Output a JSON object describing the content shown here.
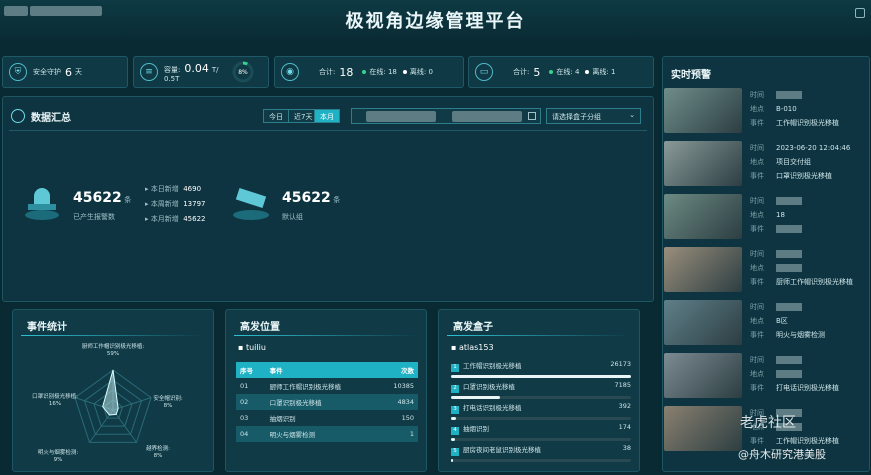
{
  "header": {
    "title": "极视角边缘管理平台"
  },
  "stats": [
    {
      "label": "安全守护",
      "value": "6",
      "unit": "天"
    },
    {
      "label": "容量:",
      "value": "0.04",
      "unit": "T/",
      "sub": "0.5T",
      "percent_label": "8%",
      "percent": 0.08
    },
    {
      "label": "合计:",
      "value": "18",
      "online_label": "在线:",
      "online": "18",
      "offline_label": "离线:",
      "offline": "0"
    },
    {
      "label": "合计:",
      "value": "5",
      "online_label": "在线:",
      "online": "4",
      "offline_label": "离线:",
      "offline": "1"
    }
  ],
  "summary": {
    "title": "数据汇总",
    "ranges": [
      "今日",
      "近7天",
      "本月"
    ],
    "active_range": "本月",
    "group_placeholder": "请选择盒子分组",
    "alarm_total": "45622",
    "alarm_unit": "条",
    "alarm_label": "已产生报警数",
    "today_label": "本日新增",
    "today_value": "4690",
    "week_label": "本周新增",
    "week_value": "13797",
    "month_label": "本月新增",
    "month_value": "45622",
    "default_total": "45622",
    "default_unit": "条",
    "default_label": "默认组"
  },
  "event_stats": {
    "title": "事件统计",
    "labels": [
      "厨师工作帽识别极光移植: 59%",
      "安全帽识别: 8%",
      "越界检测: 8%",
      "明火与烟雾检测: 9%",
      "口罩识别极光移植: 16%"
    ],
    "values": [
      59,
      8,
      8,
      9,
      16
    ]
  },
  "hot_location": {
    "title": "高发位置",
    "location": "tuiliu",
    "headers": [
      "序号",
      "事件",
      "次数"
    ],
    "rows": [
      [
        "01",
        "厨师工作帽识别极光移植",
        "10385"
      ],
      [
        "02",
        "口罩识别极光移植",
        "4834"
      ],
      [
        "03",
        "抽烟识别",
        "150"
      ],
      [
        "04",
        "明火与烟雾检测",
        "1"
      ]
    ]
  },
  "hot_box": {
    "title": "高发盒子",
    "name": "atlas153",
    "rows": [
      {
        "idx": "1",
        "label": "工作帽识别极光移植",
        "value": "26173",
        "ratio": 1
      },
      {
        "idx": "2",
        "label": "口罩识别极光移植",
        "value": "7185",
        "ratio": 0.27
      },
      {
        "idx": "3",
        "label": "打电话识别极光移植",
        "value": "392",
        "ratio": 0.03
      },
      {
        "idx": "4",
        "label": "抽烟识别",
        "value": "174",
        "ratio": 0.02
      },
      {
        "idx": "5",
        "label": "厨房夜间老鼠识别极光移植",
        "value": "38",
        "ratio": 0.01
      }
    ]
  },
  "realtime": {
    "title": "实时预警",
    "time_label": "时间",
    "place_label": "地点",
    "event_label": "事件",
    "items": [
      {
        "time": "",
        "place": "B-010",
        "event": "工作帽识别极光移植"
      },
      {
        "time": "2023-06-20 12:04:46",
        "place": "项目交付组",
        "event": "口罩识别极光移植"
      },
      {
        "time": "",
        "place": "18",
        "event": ""
      },
      {
        "time": "",
        "place": "",
        "event": "厨师工作帽识别极光移植"
      },
      {
        "time": "",
        "place": "B区",
        "event": "明火与烟雾检测"
      },
      {
        "time": "",
        "place": "",
        "event": "打电话识别极光移植"
      },
      {
        "time": "",
        "place": "",
        "event": "工作帽识别极光移植"
      }
    ]
  },
  "watermark": {
    "line1": "老虎社区",
    "line2": "@舟木研究港美股"
  }
}
